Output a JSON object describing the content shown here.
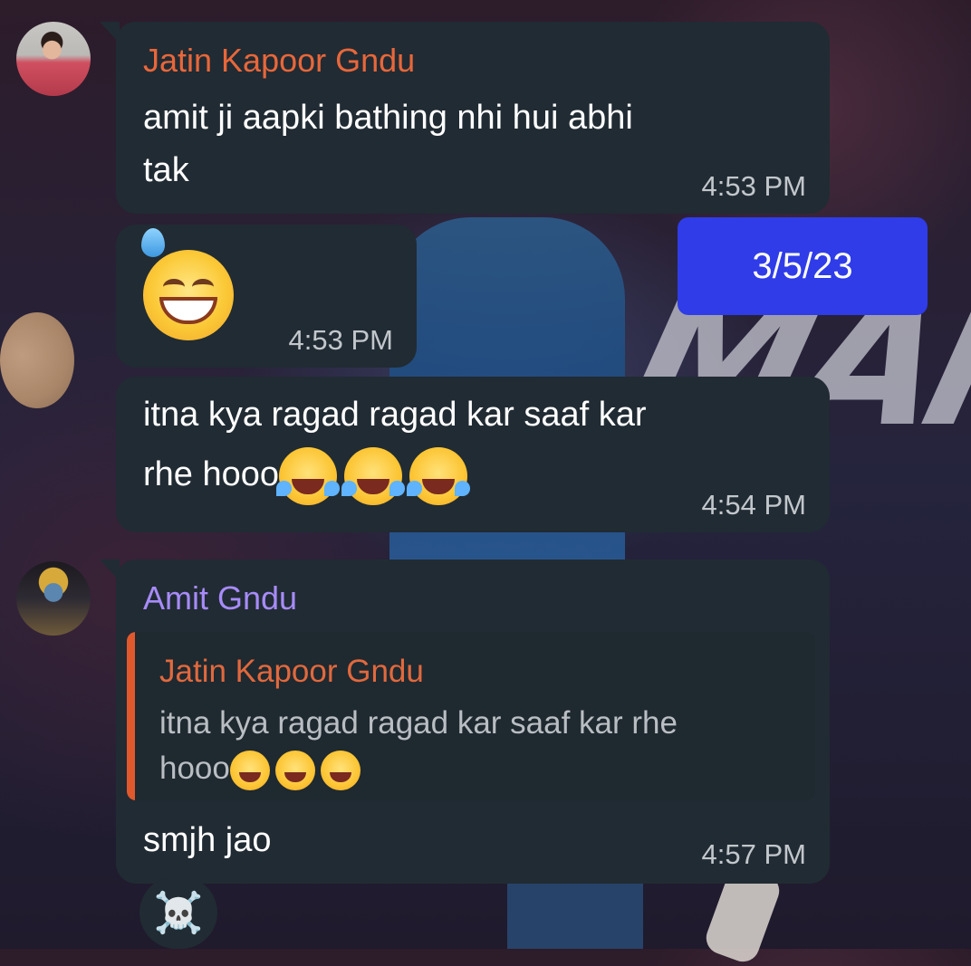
{
  "colors": {
    "bubble_bg": "#212b33",
    "date_chip_bg": "#2f3ce8",
    "jatin_name": "#e8673a",
    "amit_name": "#a78bfa",
    "quote_accent": "#e0592c"
  },
  "messages": [
    {
      "sender": "Jatin Kapoor Gndu",
      "text_line1": "amit ji aapki bathing nhi hui abhi",
      "text_line2": "tak",
      "time": "4:53 PM"
    },
    {
      "emoji": "sweat-smile-emoji",
      "time": "4:53 PM"
    },
    {
      "text_line1": "itna kya ragad ragad kar saaf kar",
      "text_line2": "rhe hooo",
      "emojis": [
        "rofl-emoji",
        "rofl-emoji",
        "rofl-emoji"
      ],
      "time": "4:54 PM"
    },
    {
      "sender": "Amit Gndu",
      "reply": {
        "sender": "Jatin Kapoor Gndu",
        "text_line1": "itna kya ragad ragad kar saaf kar rhe",
        "text_line2": "hooo"
      },
      "text": "smjh jao",
      "time": "4:57 PM",
      "reaction": "☠️"
    }
  ],
  "date_chip": "3/5/23"
}
